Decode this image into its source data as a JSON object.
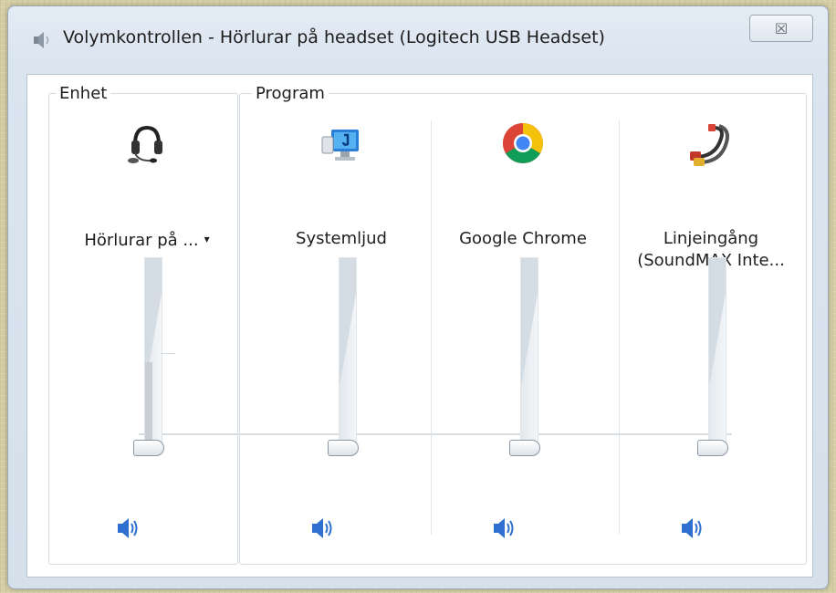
{
  "window": {
    "title": "Volymkontrollen - Hörlurar på headset (Logitech USB Headset)",
    "close_glyph": "☒"
  },
  "groups": {
    "device_label": "Enhet",
    "program_label": "Program"
  },
  "channels": [
    {
      "id": "device",
      "label_lines": [
        "Hörlurar på ..."
      ],
      "has_dropdown": true,
      "caret": "▾",
      "icon": "headset-icon",
      "level": 0.0,
      "muted": false
    },
    {
      "id": "systemljud",
      "label_lines": [
        "Systemljud"
      ],
      "icon": "system-sounds-icon",
      "level": 0.0,
      "muted": false
    },
    {
      "id": "chrome",
      "label_lines": [
        "Google Chrome"
      ],
      "icon": "google-chrome-icon",
      "level": 0.0,
      "muted": false
    },
    {
      "id": "linein",
      "label_lines": [
        "Linjeingång",
        "(SoundMAX Inte..."
      ],
      "icon": "rca-cable-icon",
      "level": 0.0,
      "muted": false
    }
  ],
  "colors": {
    "speaker_blue": "#2f6fd0",
    "window_frame": "#dbe5f0",
    "background": "#d6cfa6"
  }
}
